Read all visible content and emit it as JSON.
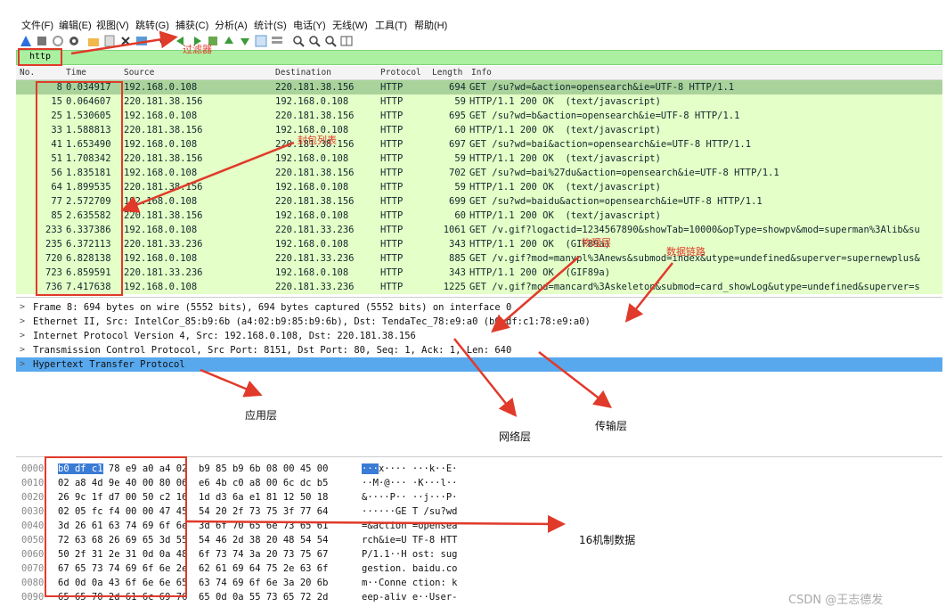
{
  "menu": [
    "文件(F)",
    "编辑(E)",
    "视图(V)",
    "跳转(G)",
    "捕获(C)",
    "分析(A)",
    "统计(S)",
    "电话(Y)",
    "无线(W)",
    "工具(T)",
    "帮助(H)"
  ],
  "filter": {
    "value": "http"
  },
  "columns": {
    "no": "No.",
    "time": "Time",
    "source": "Source",
    "destination": "Destination",
    "protocol": "Protocol",
    "length": "Length",
    "info": "Info"
  },
  "packets": [
    {
      "no": "8",
      "time": "0.034917",
      "source": "192.168.0.108",
      "destination": "220.181.38.156",
      "protocol": "HTTP",
      "length": "694",
      "info": "GET /su?wd=&action=opensearch&ie=UTF-8 HTTP/1.1",
      "selected": true
    },
    {
      "no": "15",
      "time": "0.064607",
      "source": "220.181.38.156",
      "destination": "192.168.0.108",
      "protocol": "HTTP",
      "length": "59",
      "info": "HTTP/1.1 200 OK  (text/javascript)"
    },
    {
      "no": "25",
      "time": "1.530605",
      "source": "192.168.0.108",
      "destination": "220.181.38.156",
      "protocol": "HTTP",
      "length": "695",
      "info": "GET /su?wd=b&action=opensearch&ie=UTF-8 HTTP/1.1"
    },
    {
      "no": "33",
      "time": "1.588813",
      "source": "220.181.38.156",
      "destination": "192.168.0.108",
      "protocol": "HTTP",
      "length": "60",
      "info": "HTTP/1.1 200 OK  (text/javascript)"
    },
    {
      "no": "41",
      "time": "1.653490",
      "source": "192.168.0.108",
      "destination": "220.181.38.156",
      "protocol": "HTTP",
      "length": "697",
      "info": "GET /su?wd=bai&action=opensearch&ie=UTF-8 HTTP/1.1"
    },
    {
      "no": "51",
      "time": "1.708342",
      "source": "220.181.38.156",
      "destination": "192.168.0.108",
      "protocol": "HTTP",
      "length": "59",
      "info": "HTTP/1.1 200 OK  (text/javascript)"
    },
    {
      "no": "56",
      "time": "1.835181",
      "source": "192.168.0.108",
      "destination": "220.181.38.156",
      "protocol": "HTTP",
      "length": "702",
      "info": "GET /su?wd=bai%27du&action=opensearch&ie=UTF-8 HTTP/1.1"
    },
    {
      "no": "64",
      "time": "1.899535",
      "source": "220.181.38.156",
      "destination": "192.168.0.108",
      "protocol": "HTTP",
      "length": "59",
      "info": "HTTP/1.1 200 OK  (text/javascript)"
    },
    {
      "no": "77",
      "time": "2.572709",
      "source": "192.168.0.108",
      "destination": "220.181.38.156",
      "protocol": "HTTP",
      "length": "699",
      "info": "GET /su?wd=baidu&action=opensearch&ie=UTF-8 HTTP/1.1"
    },
    {
      "no": "85",
      "time": "2.635582",
      "source": "220.181.38.156",
      "destination": "192.168.0.108",
      "protocol": "HTTP",
      "length": "60",
      "info": "HTTP/1.1 200 OK  (text/javascript)"
    },
    {
      "no": "233",
      "time": "6.337386",
      "source": "192.168.0.108",
      "destination": "220.181.33.236",
      "protocol": "HTTP",
      "length": "1061",
      "info": "GET /v.gif?logactid=1234567890&showTab=10000&opType=showpv&mod=superman%3Alib&su"
    },
    {
      "no": "235",
      "time": "6.372113",
      "source": "220.181.33.236",
      "destination": "192.168.0.108",
      "protocol": "HTTP",
      "length": "343",
      "info": "HTTP/1.1 200 OK  (GIF89a)"
    },
    {
      "no": "720",
      "time": "6.828138",
      "source": "192.168.0.108",
      "destination": "220.181.33.236",
      "protocol": "HTTP",
      "length": "885",
      "info": "GET /v.gif?mod=manypl%3Anews&submod=index&utype=undefined&superver=supernewplus&"
    },
    {
      "no": "723",
      "time": "6.859591",
      "source": "220.181.33.236",
      "destination": "192.168.0.108",
      "protocol": "HTTP",
      "length": "343",
      "info": "HTTP/1.1 200 OK  (GIF89a)"
    },
    {
      "no": "736",
      "time": "7.417638",
      "source": "192.168.0.108",
      "destination": "220.181.33.236",
      "protocol": "HTTP",
      "length": "1225",
      "info": "GET /v.gif?mod=mancard%3Askeleton&submod=card_showLog&utype=undefined&superver=s"
    }
  ],
  "details": [
    "Frame 8: 694 bytes on wire (5552 bits), 694 bytes captured (5552 bits) on interface 0",
    "Ethernet II, Src: IntelCor_85:b9:6b (a4:02:b9:85:b9:6b), Dst: TendaTec_78:e9:a0 (b0:df:c1:78:e9:a0)",
    "Internet Protocol Version 4, Src: 192.168.0.108, Dst: 220.181.38.156",
    "Transmission Control Protocol, Src Port: 8151, Dst Port: 80, Seq: 1, Ack: 1, Len: 640",
    "Hypertext Transfer Protocol"
  ],
  "hex_rows": [
    {
      "offset": "0000",
      "hex": "b0 df c1 78 e9 a0 a4 02  b9 85 b9 6b 08 00 45 00",
      "ascii": "···x···· ···k··E·"
    },
    {
      "offset": "0010",
      "hex": "02 a8 4d 9e 40 00 80 06  e6 4b c0 a8 00 6c dc b5",
      "ascii": "··M·@··· ·K···l··"
    },
    {
      "offset": "0020",
      "hex": "26 9c 1f d7 00 50 c2 16  1d d3 6a e1 81 12 50 18",
      "ascii": "&····P·· ··j···P·"
    },
    {
      "offset": "0030",
      "hex": "02 05 fc f4 00 00 47 45  54 20 2f 73 75 3f 77 64",
      "ascii": "······GE T /su?wd"
    },
    {
      "offset": "0040",
      "hex": "3d 26 61 63 74 69 6f 6e  3d 6f 70 65 6e 73 65 61",
      "ascii": "=&action =opensea"
    },
    {
      "offset": "0050",
      "hex": "72 63 68 26 69 65 3d 55  54 46 2d 38 20 48 54 54",
      "ascii": "rch&ie=U TF-8 HTT"
    },
    {
      "offset": "0060",
      "hex": "50 2f 31 2e 31 0d 0a 48  6f 73 74 3a 20 73 75 67",
      "ascii": "P/1.1··H ost: sug"
    },
    {
      "offset": "0070",
      "hex": "67 65 73 74 69 6f 6e 2e  62 61 69 64 75 2e 63 6f",
      "ascii": "gestion. baidu.co"
    },
    {
      "offset": "0080",
      "hex": "6d 0d 0a 43 6f 6e 6e 65  63 74 69 6f 6e 3a 20 6b",
      "ascii": "m··Conne ction: k"
    },
    {
      "offset": "0090",
      "hex": "65 65 70 2d 61 6c 69 76  65 0d 0a 55 73 65 72 2d",
      "ascii": "eep-aliv e··User-"
    }
  ],
  "annotations": {
    "filter": "过滤器",
    "packet_list": "封包列表",
    "physical": "物理层",
    "datalink": "数据链路",
    "application": "应用层",
    "network": "网络层",
    "transport": "传输层",
    "hexdata": "16机制数据"
  },
  "watermark": "CSDN @王志德发",
  "colors": {
    "row_bg": "#e4ffc7",
    "row_selected": "#a9d39a",
    "filter_bg": "#aaf0a0",
    "detail_selected": "#58a8ee",
    "annotation": "#e03a2a"
  }
}
